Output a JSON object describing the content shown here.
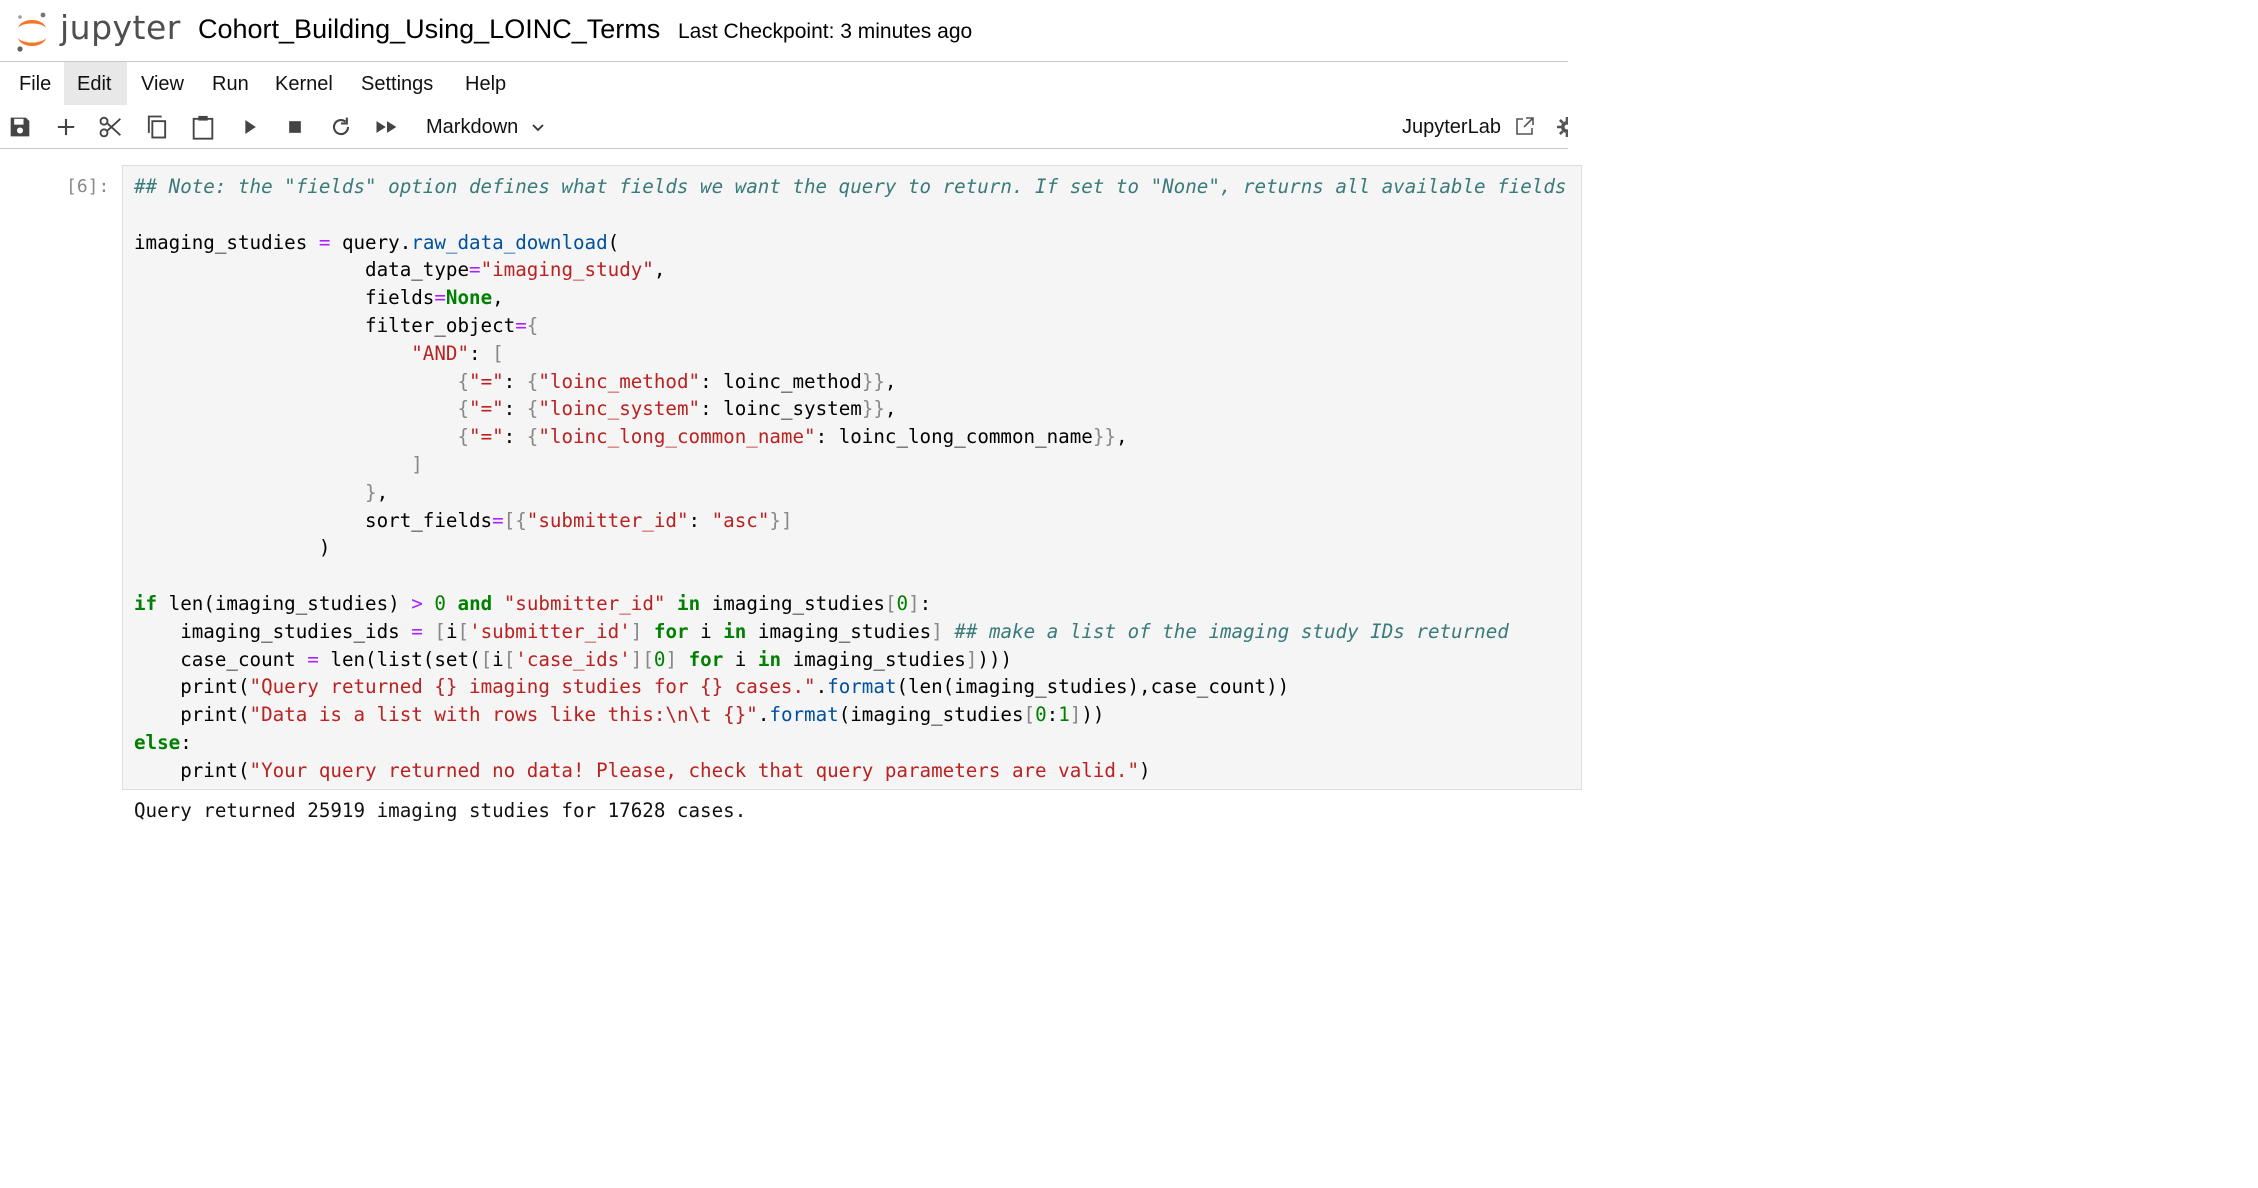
{
  "header": {
    "logo_text": "jupyter",
    "notebook_title": "Cohort_Building_Using_LOINC_Terms",
    "checkpoint": "Last Checkpoint: 3 minutes ago"
  },
  "menu": {
    "items": [
      "File",
      "Edit",
      "View",
      "Run",
      "Kernel",
      "Settings",
      "Help"
    ],
    "active": "Edit"
  },
  "toolbar": {
    "buttons": [
      "save-icon",
      "add-icon",
      "cut-icon",
      "copy-icon",
      "paste-icon",
      "run-icon",
      "stop-icon",
      "restart-icon",
      "fast-forward-icon"
    ],
    "cell_type": "Markdown",
    "jupyterlab_label": "JupyterLab"
  },
  "cell": {
    "prompt": "[6]:",
    "code_lines": [
      [
        [
          "cm",
          "## Note: the \"fields\" option defines what fields we want the query to return. If set to \"None\", returns all available fields"
        ]
      ],
      [],
      [
        [
          "",
          "imaging_studies "
        ],
        [
          "op",
          "="
        ],
        [
          "",
          " query."
        ],
        [
          "fn",
          "raw_data_download"
        ],
        [
          "",
          "("
        ]
      ],
      [
        [
          "",
          "                    data_type"
        ],
        [
          "op",
          "="
        ],
        [
          "st",
          "\"imaging_study\""
        ],
        [
          "",
          ","
        ]
      ],
      [
        [
          "",
          "                    fields"
        ],
        [
          "op",
          "="
        ],
        [
          "kw",
          "None"
        ],
        [
          "",
          ","
        ]
      ],
      [
        [
          "",
          "                    filter_object"
        ],
        [
          "op",
          "="
        ],
        [
          "br",
          "{"
        ]
      ],
      [
        [
          "",
          "                        "
        ],
        [
          "st",
          "\"AND\""
        ],
        [
          "",
          ": "
        ],
        [
          "br",
          "["
        ]
      ],
      [
        [
          "",
          "                            "
        ],
        [
          "br",
          "{"
        ],
        [
          "st",
          "\"=\""
        ],
        [
          "",
          ": "
        ],
        [
          "br",
          "{"
        ],
        [
          "st",
          "\"loinc_method\""
        ],
        [
          "",
          ": loinc_method"
        ],
        [
          "br",
          "}}"
        ],
        [
          "",
          ","
        ]
      ],
      [
        [
          "",
          "                            "
        ],
        [
          "br",
          "{"
        ],
        [
          "st",
          "\"=\""
        ],
        [
          "",
          ": "
        ],
        [
          "br",
          "{"
        ],
        [
          "st",
          "\"loinc_system\""
        ],
        [
          "",
          ": loinc_system"
        ],
        [
          "br",
          "}}"
        ],
        [
          "",
          ","
        ]
      ],
      [
        [
          "",
          "                            "
        ],
        [
          "br",
          "{"
        ],
        [
          "st",
          "\"=\""
        ],
        [
          "",
          ": "
        ],
        [
          "br",
          "{"
        ],
        [
          "st",
          "\"loinc_long_common_name\""
        ],
        [
          "",
          ": loinc_long_common_name"
        ],
        [
          "br",
          "}}"
        ],
        [
          "",
          ","
        ]
      ],
      [
        [
          "",
          "                        "
        ],
        [
          "br",
          "]"
        ]
      ],
      [
        [
          "",
          "                    "
        ],
        [
          "br",
          "}"
        ],
        [
          "",
          ","
        ]
      ],
      [
        [
          "",
          "                    sort_fields"
        ],
        [
          "op",
          "="
        ],
        [
          "br",
          "[{"
        ],
        [
          "st",
          "\"submitter_id\""
        ],
        [
          "",
          ": "
        ],
        [
          "st",
          "\"asc\""
        ],
        [
          "br",
          "}]"
        ]
      ],
      [
        [
          "",
          "                )"
        ]
      ],
      [],
      [
        [
          "kw",
          "if"
        ],
        [
          "",
          " len(imaging_studies) "
        ],
        [
          "op",
          ">"
        ],
        [
          "",
          " "
        ],
        [
          "nm",
          "0"
        ],
        [
          "",
          " "
        ],
        [
          "kw",
          "and"
        ],
        [
          "",
          " "
        ],
        [
          "st",
          "\"submitter_id\""
        ],
        [
          "",
          " "
        ],
        [
          "kw",
          "in"
        ],
        [
          "",
          " imaging_studies"
        ],
        [
          "br",
          "["
        ],
        [
          "nm",
          "0"
        ],
        [
          "br",
          "]"
        ],
        [
          "",
          ":"
        ]
      ],
      [
        [
          "",
          "    imaging_studies_ids "
        ],
        [
          "op",
          "="
        ],
        [
          "",
          " "
        ],
        [
          "br",
          "["
        ],
        [
          "",
          "i"
        ],
        [
          "br",
          "["
        ],
        [
          "st",
          "'submitter_id'"
        ],
        [
          "br",
          "]"
        ],
        [
          "",
          " "
        ],
        [
          "kw",
          "for"
        ],
        [
          "",
          " i "
        ],
        [
          "kw",
          "in"
        ],
        [
          "",
          " imaging_studies"
        ],
        [
          "br",
          "]"
        ],
        [
          "",
          " "
        ],
        [
          "cm",
          "## make a list of the imaging study IDs returned"
        ]
      ],
      [
        [
          "",
          "    case_count "
        ],
        [
          "op",
          "="
        ],
        [
          "",
          " len(list(set("
        ],
        [
          "br",
          "["
        ],
        [
          "",
          "i"
        ],
        [
          "br",
          "["
        ],
        [
          "st",
          "'case_ids'"
        ],
        [
          "br",
          "]["
        ],
        [
          "nm",
          "0"
        ],
        [
          "br",
          "]"
        ],
        [
          "",
          " "
        ],
        [
          "kw",
          "for"
        ],
        [
          "",
          " i "
        ],
        [
          "kw",
          "in"
        ],
        [
          "",
          " imaging_studies"
        ],
        [
          "br",
          "]"
        ],
        [
          "",
          ")))"
        ]
      ],
      [
        [
          "",
          "    print("
        ],
        [
          "st",
          "\"Query returned {} imaging studies for {} cases.\""
        ],
        [
          "",
          "."
        ],
        [
          "fn",
          "format"
        ],
        [
          "",
          "(len(imaging_studies),case_count))"
        ]
      ],
      [
        [
          "",
          "    print("
        ],
        [
          "st",
          "\"Data is a list with rows like this:\\n\\t {}\""
        ],
        [
          "",
          "."
        ],
        [
          "fn",
          "format"
        ],
        [
          "",
          "(imaging_studies"
        ],
        [
          "br",
          "["
        ],
        [
          "nm",
          "0"
        ],
        [
          "",
          ":"
        ],
        [
          "nm",
          "1"
        ],
        [
          "br",
          "]"
        ],
        [
          "",
          "))"
        ]
      ],
      [
        [
          "kw",
          "else"
        ],
        [
          "",
          ":"
        ]
      ],
      [
        [
          "",
          "    print("
        ],
        [
          "st",
          "\"Your query returned no data! Please, check that query parameters are valid.\""
        ],
        [
          "",
          ")"
        ]
      ]
    ],
    "output": "Query returned 25919 imaging studies for 17628 cases."
  },
  "colors": {
    "comment": "#3a7a7a",
    "string": "#ba2121",
    "keyword": "#008000",
    "operator": "#aa22ff",
    "function": "#0050a0",
    "bracket": "#888888",
    "logo_orange": "#f37726"
  }
}
